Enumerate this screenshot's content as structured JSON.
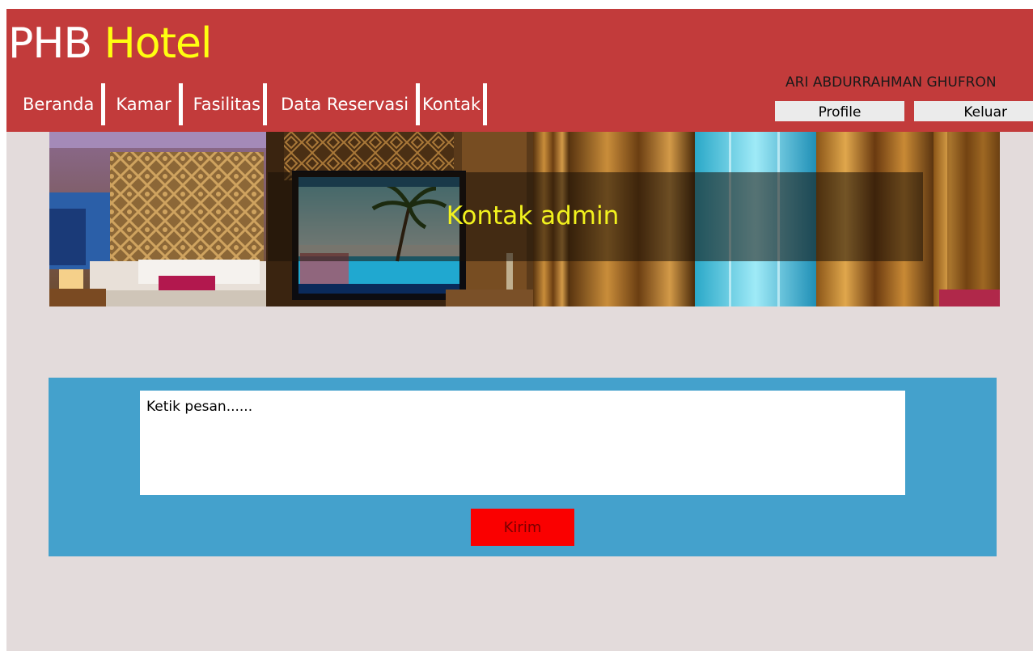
{
  "header": {
    "brand_part1": "PHB",
    "brand_part2": "Hotel",
    "nav": [
      "Beranda",
      "Kamar",
      "Fasilitas",
      "Data Reservasi",
      "Kontak"
    ],
    "user_name": "ARI ABDURRAHMAN GHUFRON",
    "profile_label": "Profile",
    "logout_label": "Keluar"
  },
  "banner": {
    "title": "Kontak admin"
  },
  "contact_form": {
    "message_placeholder": "Ketik pesan......",
    "message_value": "",
    "submit_label": "Kirim"
  },
  "colors": {
    "header_bg": "#c23b3b",
    "brand_accent": "#ffff10",
    "page_bg": "#e3dbdb",
    "form_bg": "#44a1cc",
    "submit_bg": "#fa0000",
    "banner_title": "#f2f21e"
  }
}
